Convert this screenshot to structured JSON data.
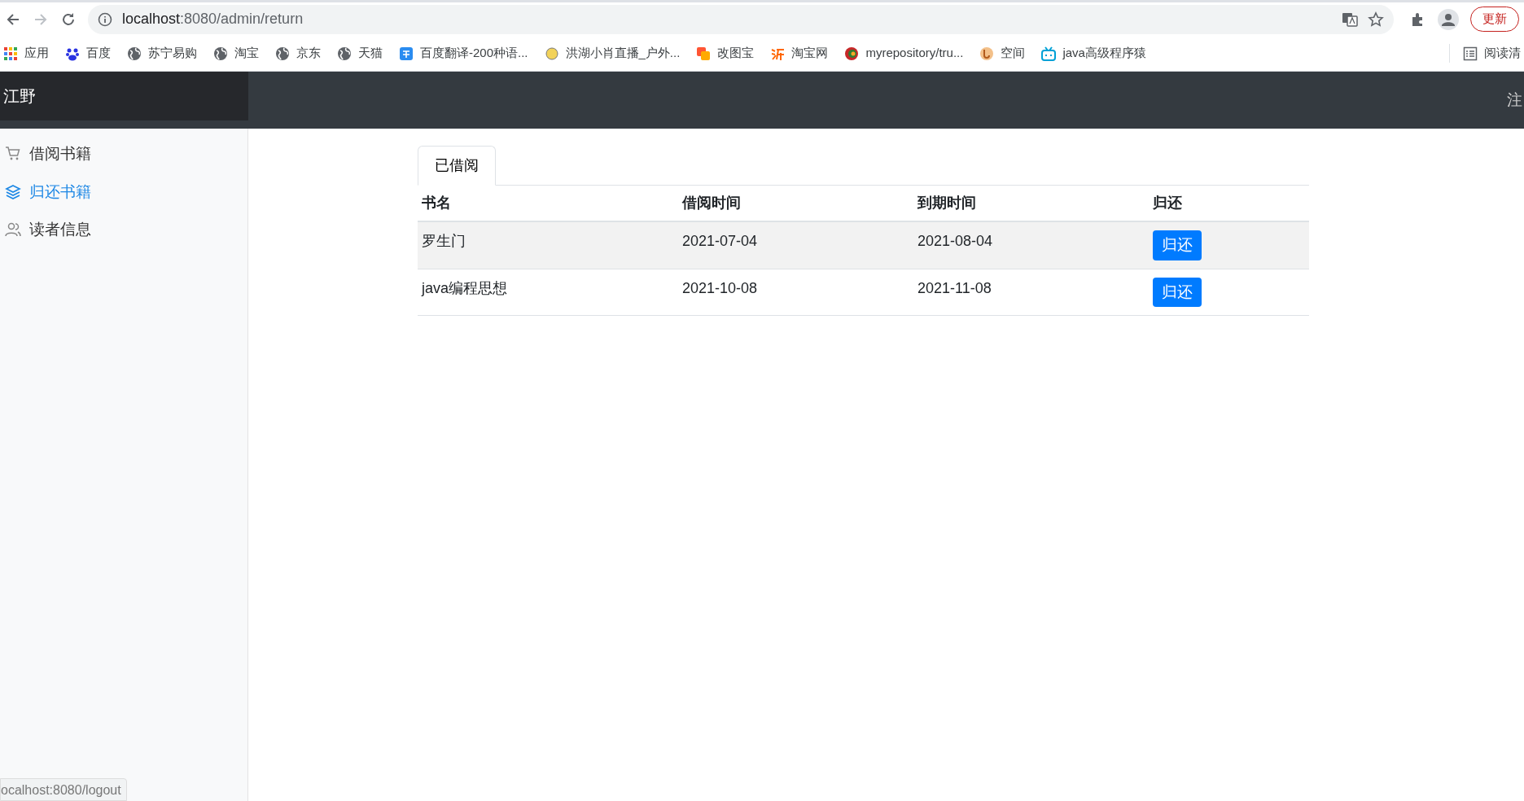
{
  "browser": {
    "url_host": "localhost",
    "url_path": ":8080/admin/return",
    "update_button": "更新",
    "reading_list": "阅读清",
    "bookmarks": [
      {
        "label": "应用"
      },
      {
        "label": "百度"
      },
      {
        "label": "苏宁易购"
      },
      {
        "label": "淘宝"
      },
      {
        "label": "京东"
      },
      {
        "label": "天猫"
      },
      {
        "label": "百度翻译-200种语..."
      },
      {
        "label": "洪湖小肖直播_户外..."
      },
      {
        "label": "改图宝"
      },
      {
        "label": "淘宝网"
      },
      {
        "label": "myrepository/tru..."
      },
      {
        "label": "空间"
      },
      {
        "label": "java高级程序猿"
      }
    ]
  },
  "navbar": {
    "brand": "江野",
    "right_text": "注"
  },
  "sidebar": {
    "items": [
      {
        "label": "借阅书籍",
        "selected": false
      },
      {
        "label": "归还书籍",
        "selected": true
      },
      {
        "label": "读者信息",
        "selected": false
      }
    ]
  },
  "tabs": [
    {
      "label": "已借阅",
      "selected": true
    }
  ],
  "table": {
    "columns": [
      "书名",
      "借阅时间",
      "到期时间",
      "归还"
    ],
    "rows": [
      {
        "cells": [
          "罗生门",
          "2021-07-04",
          "2021-08-04"
        ],
        "action": "归还"
      },
      {
        "cells": [
          "java编程思想",
          "2021-10-08",
          "2021-11-08"
        ],
        "action": "归还"
      }
    ]
  },
  "status_bar": {
    "text": "ocalhost:8080/logout"
  }
}
